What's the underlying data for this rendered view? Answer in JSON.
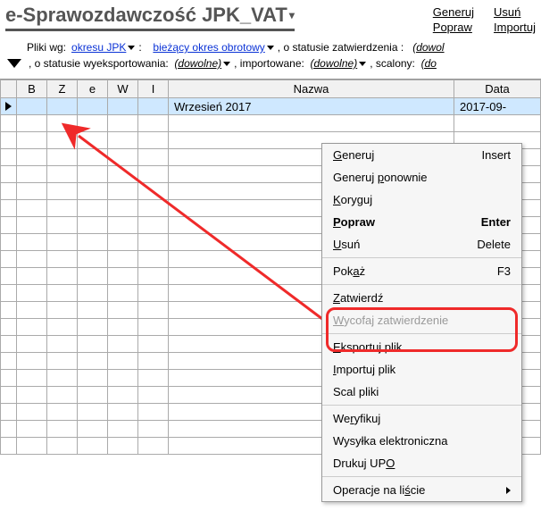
{
  "header": {
    "title": "e-Sprawozdawczość JPK_VAT",
    "links": {
      "generuj": "Generuj",
      "usun": "Usuń",
      "popraw": "Popraw",
      "importuj": "Importuj"
    }
  },
  "filters": {
    "pliki_wg": "Pliki wg:",
    "okresu_jpk": "okresu JPK",
    "colon": ":",
    "biezacy_okres": "bieżący okres obrotowy",
    "status_zatw": ", o statusie zatwierdzenia :",
    "dowol": "(dowol",
    "status_exp": ", o statusie wyeksportowania:",
    "dowolne": "(dowolne)",
    "importowane": ", importowane:",
    "scalony": ", scalony:",
    "do": "(do"
  },
  "grid": {
    "cols": {
      "b": "B",
      "z": "Z",
      "e": "e",
      "w": "W",
      "i": "I",
      "nazwa": "Nazwa",
      "data": "Data "
    },
    "row": {
      "nazwa": "Wrzesień 2017",
      "data": "2017-09-"
    }
  },
  "menu": {
    "generuj": "Generuj",
    "generuj_sc": "Insert",
    "generuj_ponownie": "Generuj ponownie",
    "koryguj": "Koryguj",
    "popraw": "Popraw",
    "popraw_sc": "Enter",
    "usun": "Usuń",
    "usun_sc": "Delete",
    "pokaz": "Pokaż",
    "pokaz_sc": "F3",
    "zatwierdz": "Zatwierdź",
    "wycofaj": "Wycofaj zatwierdzenie",
    "eksportuj": "Eksportuj plik",
    "importuj": "Importuj plik",
    "scal": "Scal pliki",
    "weryfikuj": "Weryfikuj",
    "wysylka": "Wysyłka elektroniczna",
    "drukuj": "Drukuj UPO",
    "operacje": "Operacje na liście"
  }
}
